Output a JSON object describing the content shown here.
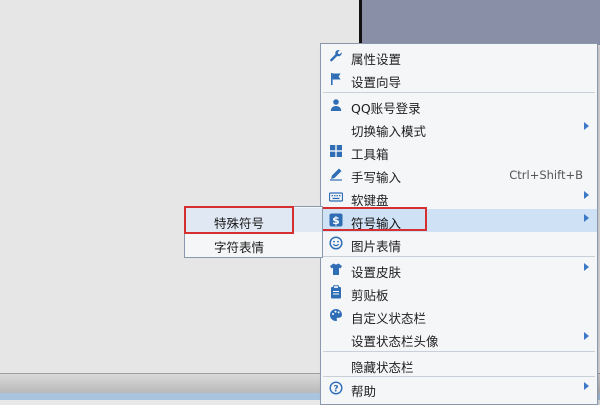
{
  "context_menu": {
    "items": [
      {
        "label": "属性设置",
        "icon": "wrench-icon"
      },
      {
        "label": "设置向导",
        "icon": "flag-icon"
      },
      {
        "label": "QQ账号登录",
        "icon": "user-icon"
      },
      {
        "label": "切换输入模式",
        "icon": "",
        "submenu": true
      },
      {
        "label": "工具箱",
        "icon": "grid-icon"
      },
      {
        "label": "手写输入",
        "icon": "pen-icon",
        "shortcut": "Ctrl+Shift+B"
      },
      {
        "label": "软键盘",
        "icon": "keyboard-icon",
        "submenu": true
      },
      {
        "label": "符号输入",
        "icon": "dollar-icon",
        "submenu": true,
        "highlighted": true
      },
      {
        "label": "图片表情",
        "icon": "smiley-icon"
      },
      {
        "label": "设置皮肤",
        "icon": "shirt-icon",
        "submenu": true
      },
      {
        "label": "剪贴板",
        "icon": "clipboard-icon"
      },
      {
        "label": "自定义状态栏",
        "icon": "palette-icon"
      },
      {
        "label": "设置状态栏头像",
        "icon": "",
        "submenu": true
      },
      {
        "label": "隐藏状态栏",
        "icon": ""
      },
      {
        "label": "帮助",
        "icon": "help-icon",
        "submenu": true
      }
    ]
  },
  "symbol_submenu": {
    "items": [
      {
        "label": "特殊符号",
        "highlighted": true
      },
      {
        "label": "字符表情"
      }
    ]
  },
  "colors": {
    "highlight": "#cfe1f5",
    "icon_blue": "#2f6db5",
    "annotation_red": "#d62f2f"
  }
}
